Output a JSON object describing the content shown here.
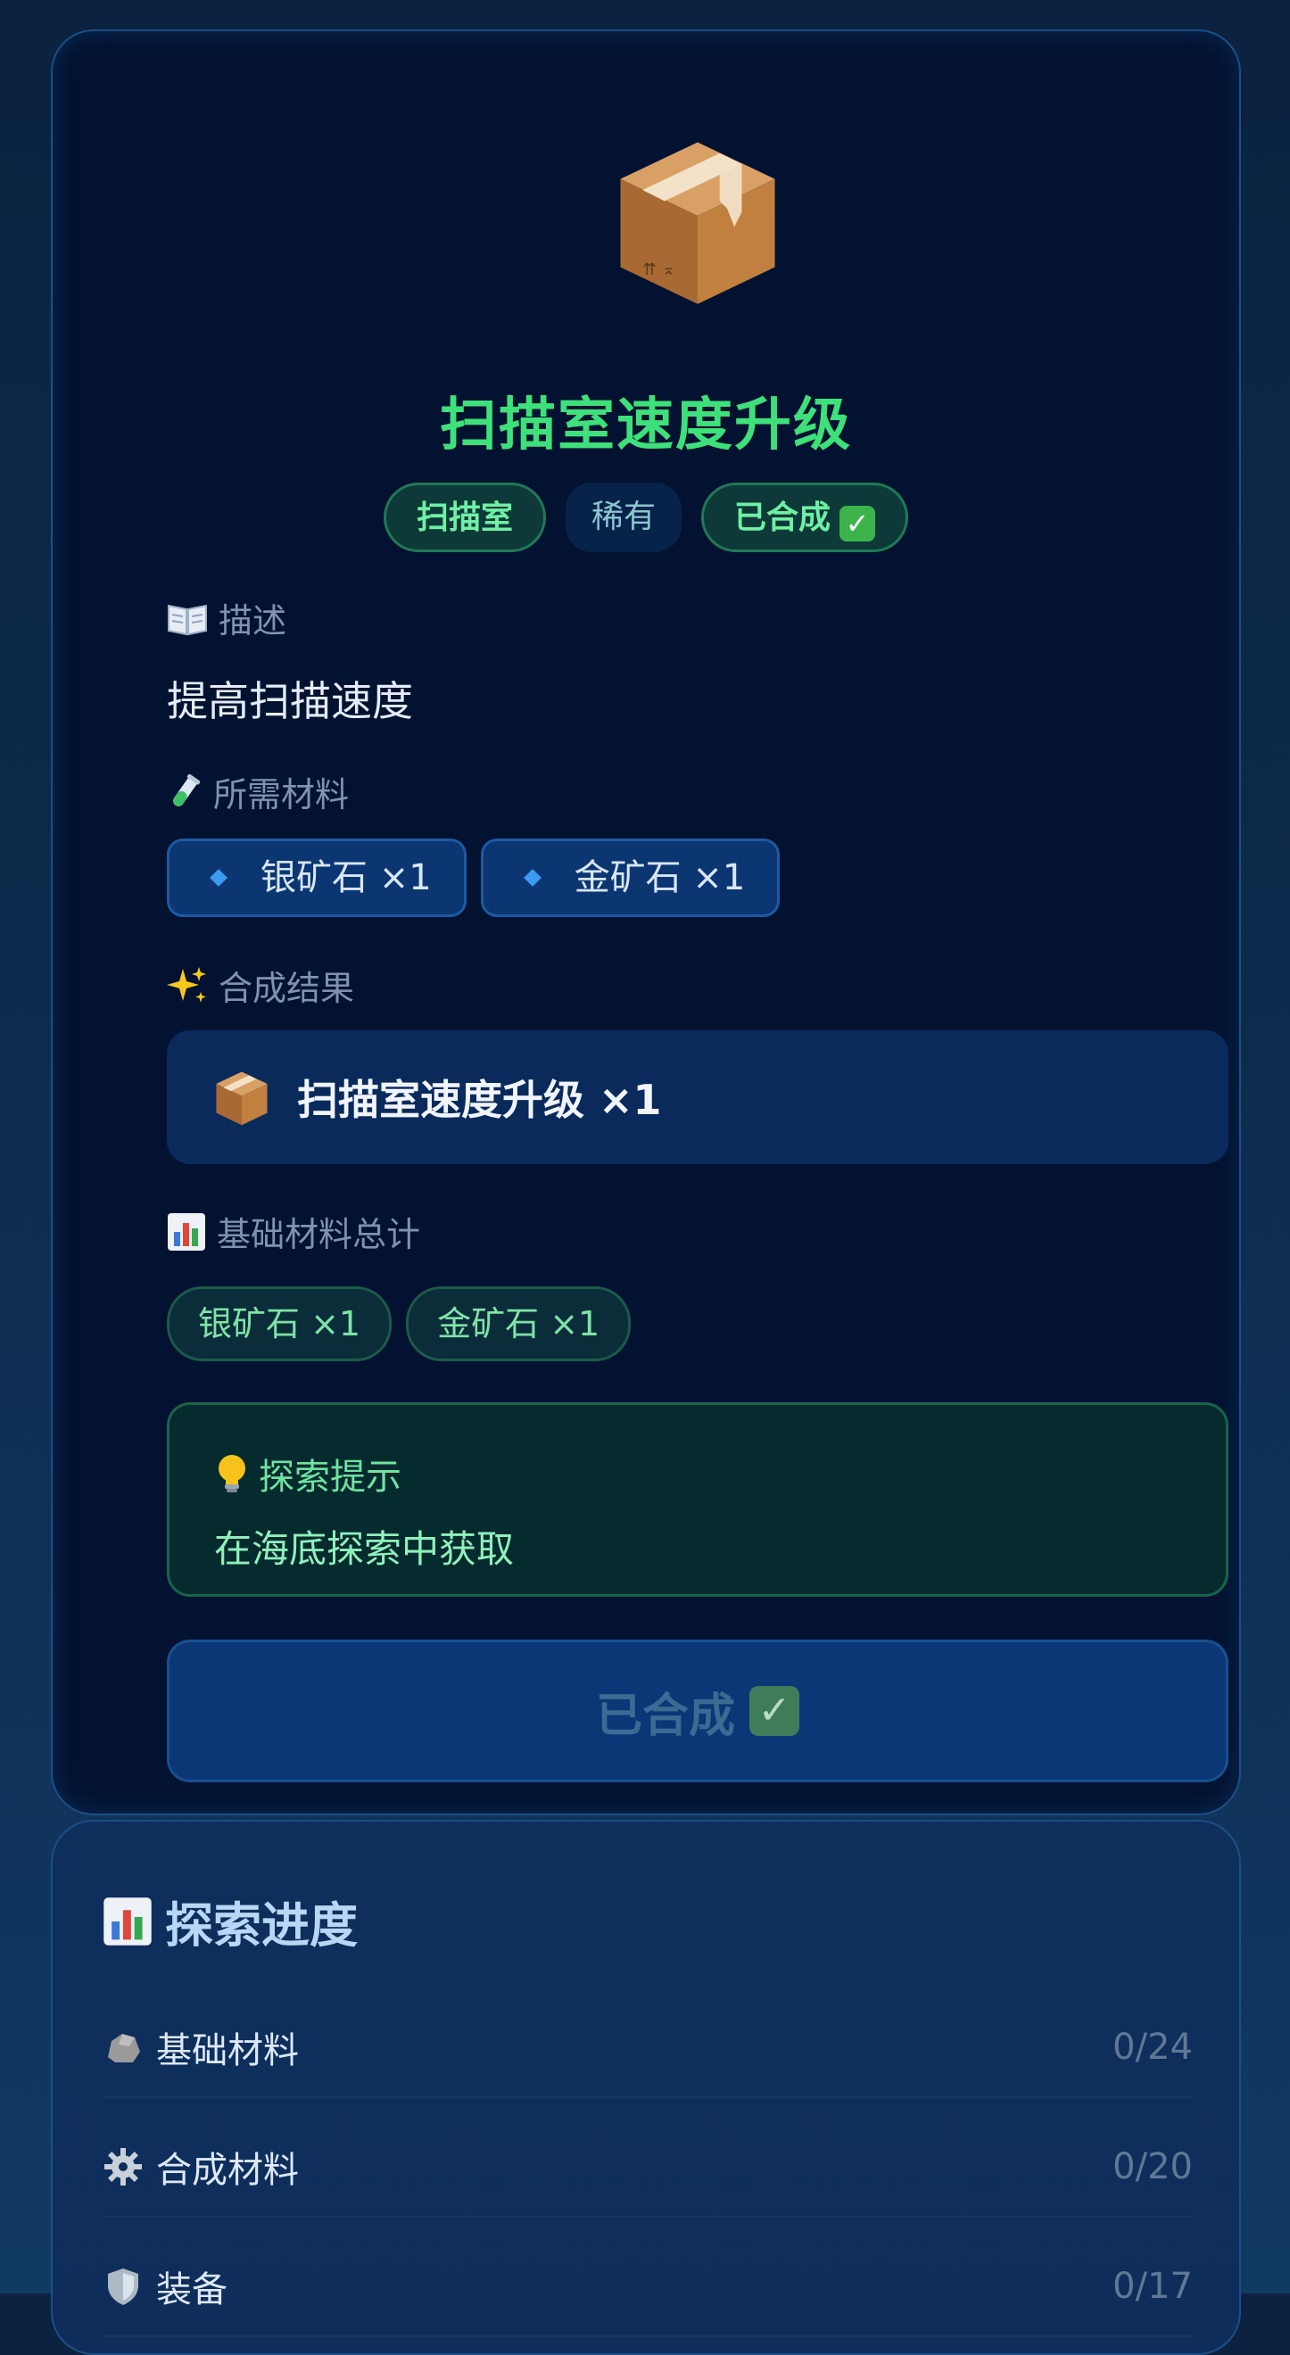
{
  "item": {
    "icon": "package-box-icon",
    "title": "扫描室速度升级",
    "tags": {
      "category": "扫描室",
      "rarity": "稀有",
      "status": "已合成"
    }
  },
  "description": {
    "icon": "open-book-icon",
    "label": "描述",
    "text": "提高扫描速度"
  },
  "materials": {
    "icon": "test-tube-icon",
    "label": "所需材料",
    "items": [
      {
        "name": "银矿石 ×1"
      },
      {
        "name": "金矿石 ×1"
      }
    ]
  },
  "result": {
    "icon": "sparkles-icon",
    "label": "合成结果",
    "text": "扫描室速度升级 ×1"
  },
  "base_total": {
    "icon": "bar-chart-icon",
    "label": "基础材料总计",
    "items": [
      "银矿石 ×1",
      "金矿石 ×1"
    ]
  },
  "hint": {
    "icon": "light-bulb-icon",
    "title": "探索提示",
    "text": "在海底探索中获取"
  },
  "craft_button": {
    "label": "已合成"
  },
  "progress": {
    "title": "探索进度",
    "rows": [
      {
        "icon": "rock-icon",
        "label": "基础材料",
        "count": "0/24"
      },
      {
        "icon": "gear-icon",
        "label": "合成材料",
        "count": "0/20"
      },
      {
        "icon": "shield-icon",
        "label": "装备",
        "count": "0/17"
      }
    ]
  },
  "colors": {
    "accent_green": "#3ee07a",
    "card_bg": "#031230",
    "chip_blue": "#0b3672"
  }
}
